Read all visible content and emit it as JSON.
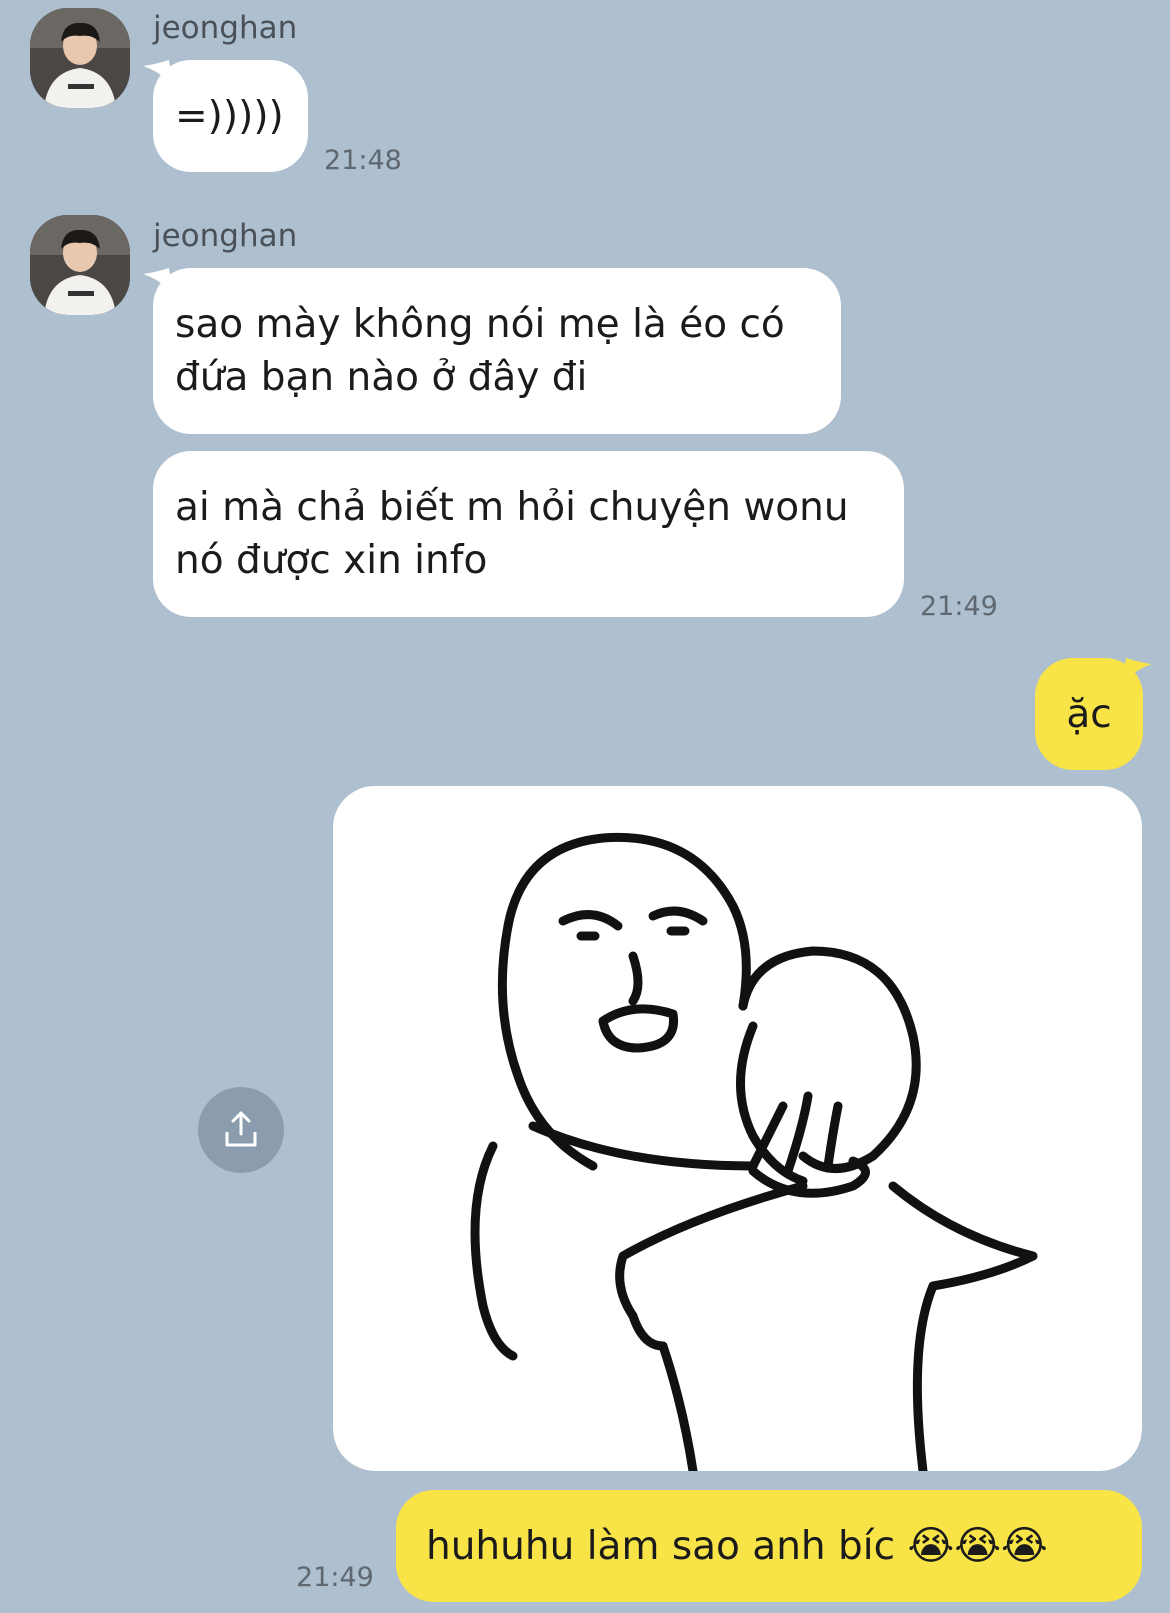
{
  "chat": {
    "messages": [
      {
        "sender": "jeonghan",
        "bubbles": [
          [
            "=)))))"
          ]
        ],
        "time": "21:48"
      },
      {
        "sender": "jeonghan",
        "bubbles": [
          [
            "sao mày không nói mẹ là éo có",
            "đứa bạn nào ở đây đi"
          ],
          [
            "ai mà chả biết m hỏi chuyện wonu",
            "nó được xin info"
          ]
        ],
        "time": "21:49"
      }
    ],
    "mine": {
      "bubble_1": "ặc",
      "image_icon": "sticker-rage-face-choking",
      "bubble_2_text": "huhuhu làm sao anh bíc ",
      "bubble_2_emojis": "😭😭😭",
      "time": "21:49"
    },
    "share_icon": "share-icon",
    "colors": {
      "background": "#aebfd0",
      "incoming_bubble": "#ffffff",
      "outgoing_bubble": "#f9e447"
    }
  }
}
